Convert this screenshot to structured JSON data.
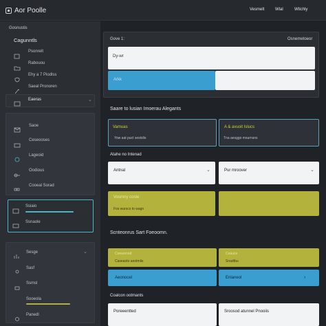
{
  "app": {
    "title": "Aor Poolle"
  },
  "topnav": [
    "Vesmelt",
    "Wlal",
    "Wtichly"
  ],
  "sidebar": {
    "header": "Gosnustis",
    "title": "Cagunntls",
    "items1": [
      "Psonrelt",
      "Rabouou",
      "Ehy a 7 Piodlss",
      "Saeal Pronoren"
    ],
    "active_item": "Eaeras",
    "items2": [
      "Saoe",
      "Ceseooses",
      "Lageoid",
      "Oodious",
      "Cooeal Sorad"
    ],
    "progress_items": [
      "Ssiaio",
      "Ssnaole"
    ],
    "items3": [
      "Sesge",
      "Sasf",
      "Ssmsl",
      "Sooeola",
      "Panedl"
    ],
    "accent": "#4fb4c8"
  },
  "main": {
    "top_panel": {
      "label": "Gove 1:",
      "right_label": "Osnemetoeor",
      "input1": "Dy-wr",
      "input2": "Arkk"
    },
    "section1": {
      "title": "Saare to lusian Imoerau Alegants",
      "card1": {
        "title": "Vamuas",
        "sub": "Yow aat puct sestslts"
      },
      "card2": {
        "title": "A & avuoit Islucs",
        "sub": "Tna aesggo msurnsns"
      }
    },
    "section2": {
      "title": "Atahe no Intenad",
      "select1": "Antnal",
      "select2": "Pur mroover",
      "olive_card": {
        "title": "Vosmny coste",
        "sub": "Fos wurscs to wagn"
      }
    },
    "section3": {
      "title": "Scnteonrus Sart Foeoomn.",
      "c1": {
        "title": "Consornod",
        "sub": "Caseaoto anotmlis"
      },
      "c2": {
        "title": "Ceauce",
        "sub": "Snadtbu"
      },
      "b1": "Aeonocel",
      "b2": "Enlaneol"
    },
    "section4": {
      "title": "Coalcon ootmants",
      "f1": "Poreeentted",
      "f2": "Sroosod atunnel Pnooiis"
    }
  },
  "colors": {
    "blue": "#3a9fd0",
    "olive": "#b3b23c",
    "white": "#f2f3f4",
    "bg": "#1f2226"
  }
}
